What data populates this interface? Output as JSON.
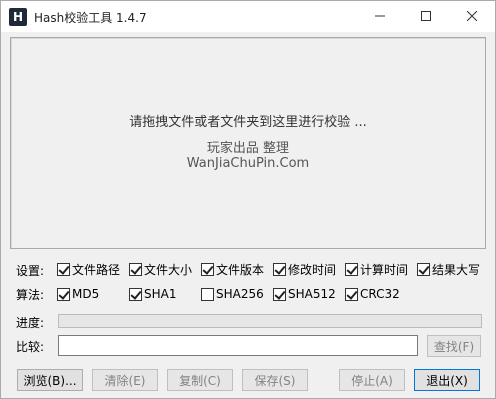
{
  "window": {
    "title": "Hash校验工具 1.4.7",
    "icon_letter": "H",
    "controls": {
      "minimize": "minimize-icon",
      "maximize": "maximize-icon",
      "close": "close-icon"
    }
  },
  "dropzone": {
    "hint": "请拖拽文件或者文件夹到这里进行校验 ...",
    "credit_line1": "玩家出品 整理",
    "credit_line2": "WanJiaChuPin.Com"
  },
  "settings": {
    "label": "设置:",
    "options": [
      {
        "label": "文件路径",
        "checked": true
      },
      {
        "label": "文件大小",
        "checked": true
      },
      {
        "label": "文件版本",
        "checked": true
      },
      {
        "label": "修改时间",
        "checked": true
      },
      {
        "label": "计算时间",
        "checked": true
      },
      {
        "label": "结果大写",
        "checked": true
      }
    ]
  },
  "algorithms": {
    "label": "算法:",
    "options": [
      {
        "label": "MD5",
        "checked": true
      },
      {
        "label": "SHA1",
        "checked": true
      },
      {
        "label": "SHA256",
        "checked": false
      },
      {
        "label": "SHA512",
        "checked": true
      },
      {
        "label": "CRC32",
        "checked": true
      }
    ]
  },
  "progress": {
    "label": "进度:",
    "value": 0
  },
  "compare": {
    "label": "比较:",
    "value": "",
    "find_button": "查找(F)"
  },
  "buttons": {
    "browse": "浏览(B)...",
    "clear": "清除(E)",
    "copy": "复制(C)",
    "save": "保存(S)",
    "stop": "停止(A)",
    "exit": "退出(X)"
  }
}
